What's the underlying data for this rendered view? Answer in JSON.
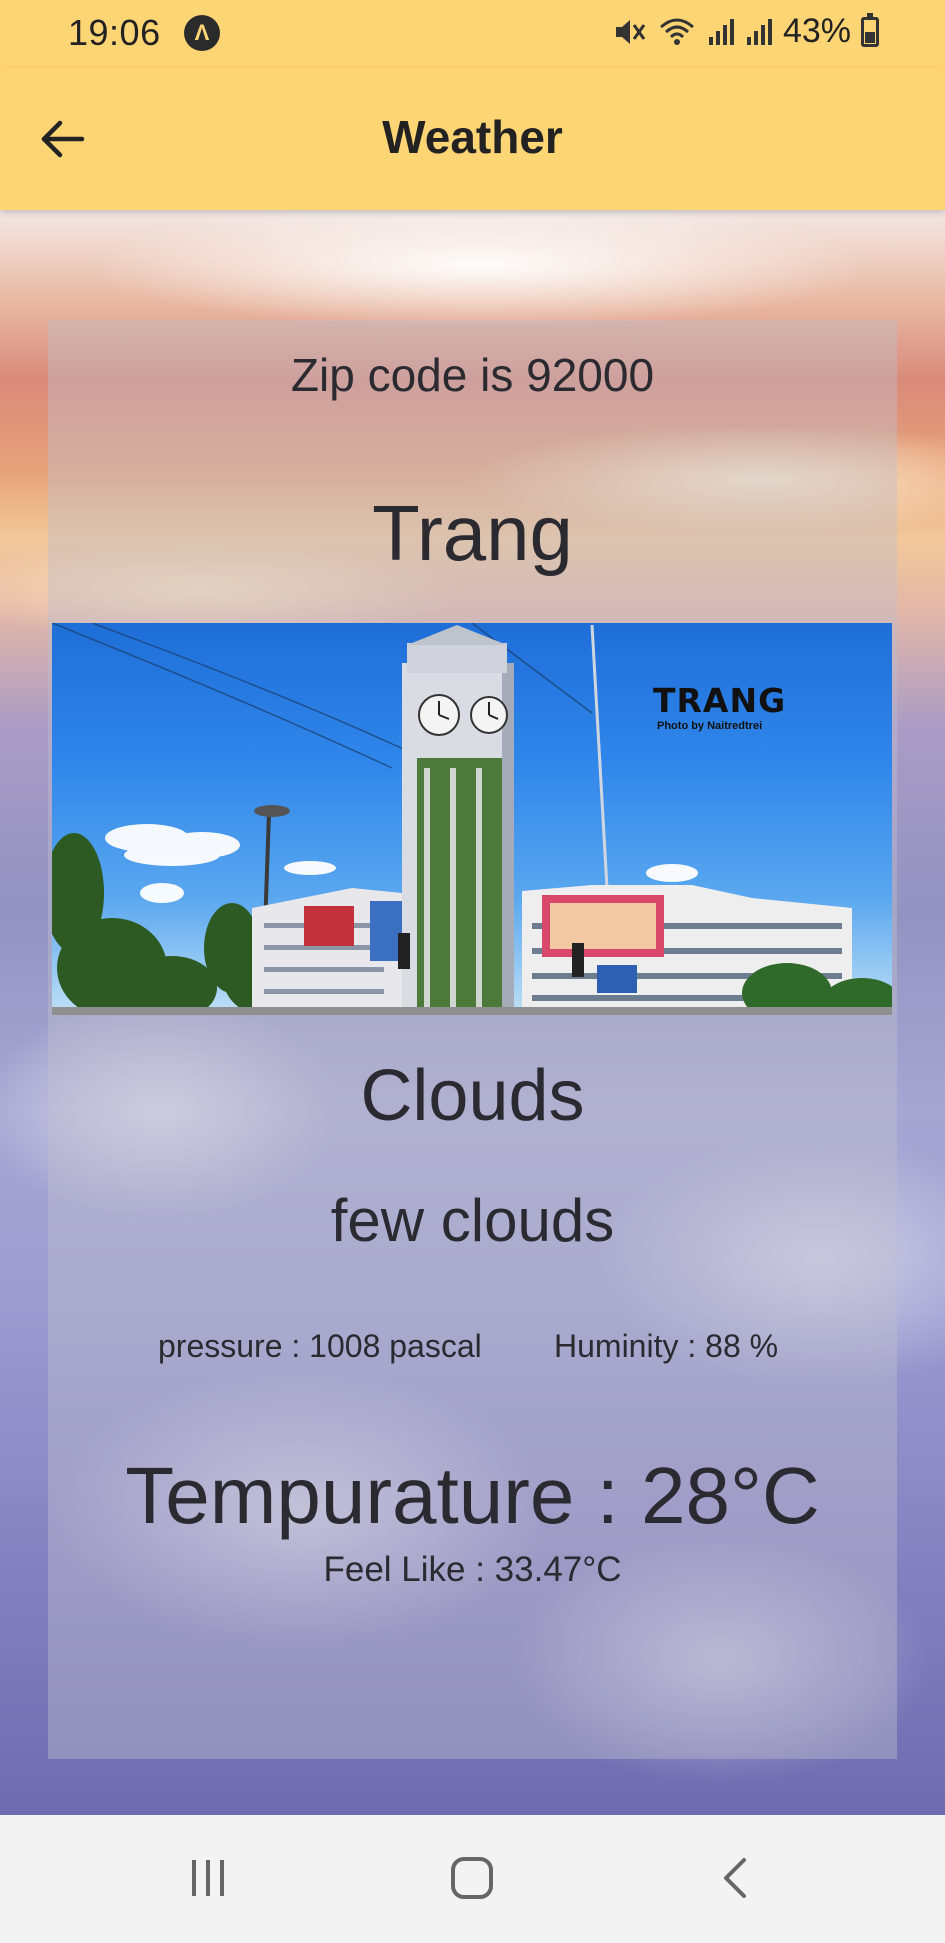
{
  "status_bar": {
    "time": "19:06",
    "app_icon_glyph": "Λ",
    "battery": "43%",
    "battery_level": 0.43,
    "icons": [
      "app-notification-icon",
      "mute-icon",
      "wifi-icon",
      "signal-icon",
      "signal-icon",
      "battery-icon"
    ]
  },
  "app_bar": {
    "title": "Weather",
    "back_icon": "arrow-left-icon"
  },
  "weather": {
    "zip_line": "Zip code is 92000",
    "city": "Trang",
    "main": "Clouds",
    "description": "few clouds",
    "pressure": "pressure : 1008 pascal",
    "humidity": "Huminity : 88 %",
    "temperature": "Tempurature : 28°C",
    "feels_like": "Feel Like : 33.47°C"
  },
  "photo": {
    "watermark_title": "TRANG",
    "watermark_sub": "Photo by Naitredtrei"
  },
  "nav_bar": {
    "icons": [
      "recent-apps-icon",
      "home-icon",
      "back-icon"
    ]
  },
  "colors": {
    "app_bar": "#fed574",
    "text_dark": "#222222",
    "card_overlay": "rgba(190,190,205,0.42)",
    "nav_bar": "#f3f3f3"
  }
}
